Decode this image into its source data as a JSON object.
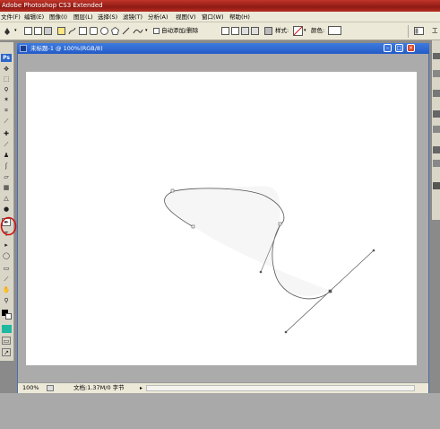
{
  "app": {
    "title": "Adobe Photoshop CS3 Extended"
  },
  "menu": {
    "items": [
      "文件(F)",
      "编辑(E)",
      "图像(I)",
      "图层(L)",
      "选择(S)",
      "滤镜(T)",
      "分析(A)",
      "视图(V)",
      "窗口(W)",
      "帮助(H)"
    ]
  },
  "options": {
    "auto_add_delete": "自动添加/删除",
    "style_label": "样式:",
    "color_label": "颜色:",
    "workspace_label": "工"
  },
  "toolbox": {
    "ps_logo": "Ps"
  },
  "document": {
    "title": "未标题-1 @ 100%(RGB/8)",
    "zoom": "100%",
    "doc_info": "文档:1.37M/0 字节"
  },
  "colors": {
    "title_bar": "#b62d22",
    "doc_title_bar": "#2e6bd8",
    "highlight_circle": "#d01010",
    "foreground_swatch": "#000000",
    "accent_swatch": "#1fb8a0"
  }
}
